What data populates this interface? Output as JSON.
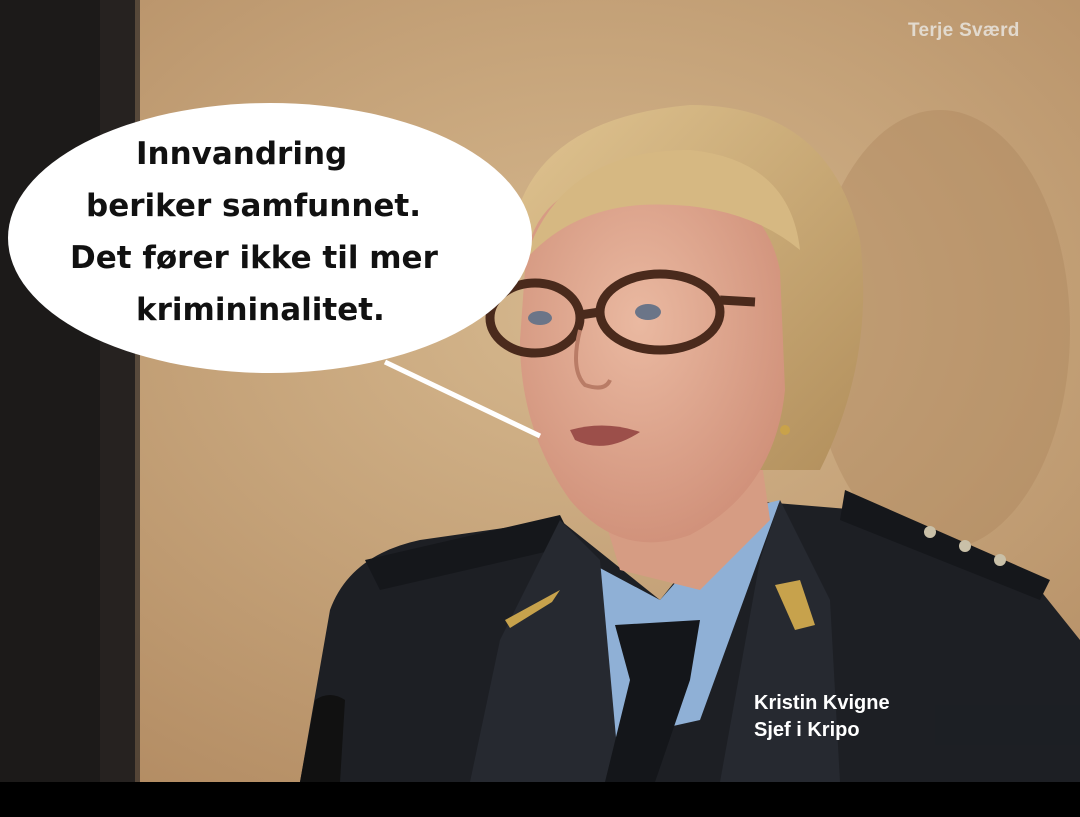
{
  "photo": {
    "description_icon": "photo-of-uniformed-officer",
    "watermark": "Terje Sværd"
  },
  "speech_bubble": {
    "lines": [
      "Innvandring",
      "beriker samfunnet.",
      "Det fører ikke til mer",
      "krimininalitet."
    ]
  },
  "caption": {
    "name": "Kristin Kvigne",
    "title": "Sjef i Kripo"
  },
  "colors": {
    "wall": "#c9a77d",
    "curtain": "#1c1a19",
    "uniform": "#1d1f24",
    "shirt": "#8fb0d6",
    "hair": "#d2b27c",
    "skin": "#e2ad93",
    "bubble": "#ffffff"
  }
}
